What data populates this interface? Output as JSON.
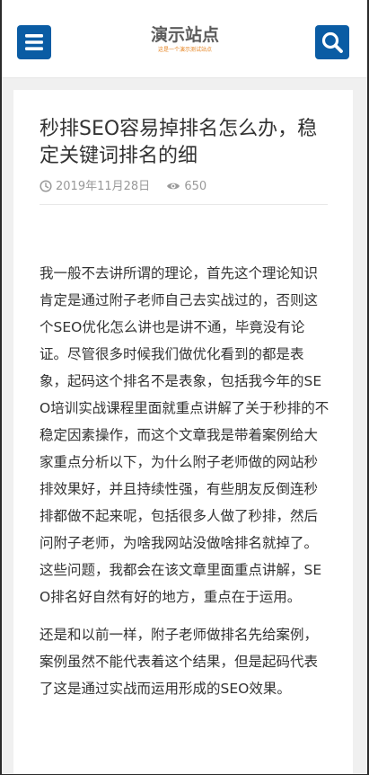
{
  "header": {
    "logo_title": "演示站点",
    "logo_subtitle": "这是一个演示测试站点",
    "menu_icon": "menu-icon",
    "search_icon": "search-icon",
    "accent_color": "#0a5ca4"
  },
  "article": {
    "title": "秒排SEO容易掉排名怎么办，稳定关键词排名的细",
    "date": "2019年11月28日",
    "views": "650",
    "date_icon": "clock-icon",
    "views_icon": "eye-icon",
    "paragraphs": [
      "我一般不去讲所谓的理论，首先这个理论知识肯定是通过附子老师自己去实战过的，否则这个SEO优化怎么讲也是讲不通，毕竟没有论证。尽管很多时候我们做优化看到的都是表象，起码这个排名不是表象，包括我今年的SEO培训实战课程里面就重点讲解了关于秒排的不稳定因素操作，而这个文章我是带着案例给大家重点分析以下，为什么附子老师做的网站秒排效果好，并且持续性强，有些朋友反倒连秒排都做不起来呢，包括很多人做了秒排，然后问附子老师，为啥我网站没做啥排名就掉了。这些问题，我都会在该文章里面重点讲解，SEO排名好自然有好的地方，重点在于运用。",
      "还是和以前一样，附子老师做排名先给案例，案例虽然不能代表着这个结果，但是起码代表了这是通过实战而运用形成的SEO效果。"
    ]
  }
}
